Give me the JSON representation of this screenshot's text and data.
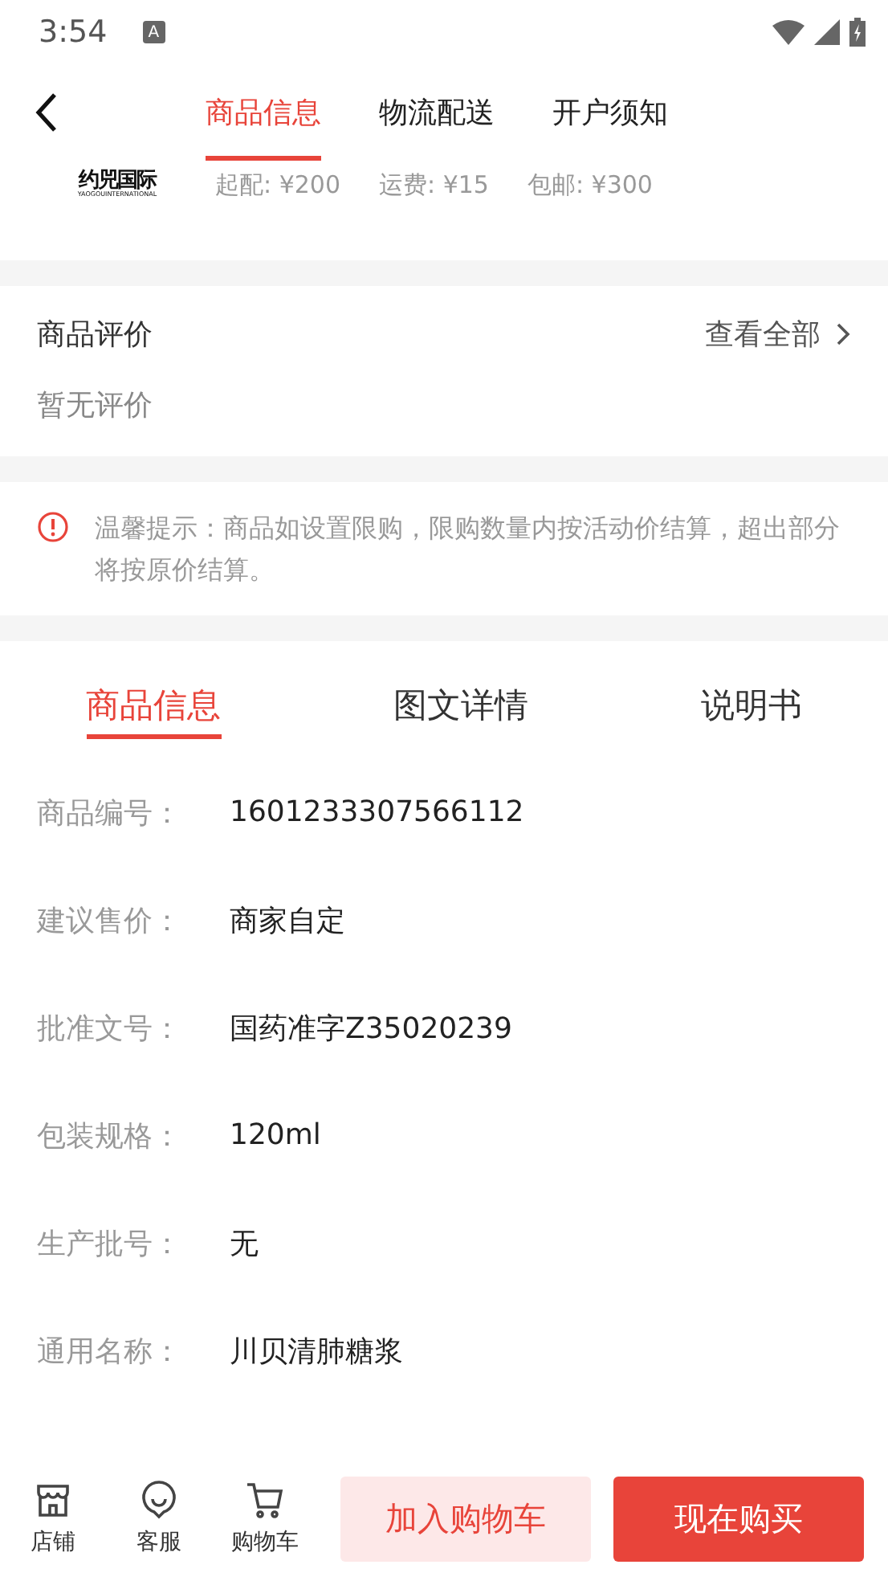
{
  "status_bar": {
    "time": "3:54",
    "notification": "A"
  },
  "header": {
    "tabs": [
      {
        "label": "商品信息",
        "selected": true
      },
      {
        "label": "物流配送",
        "selected": false
      },
      {
        "label": "开户须知",
        "selected": false
      }
    ]
  },
  "shop": {
    "logo_name": "约兕国际",
    "logo_sub": "YAOGOUINTERNATIONAL",
    "terms": [
      "起配: ¥200",
      "运费: ¥15",
      "包邮: ¥300"
    ]
  },
  "reviews": {
    "title": "商品评价",
    "link": "查看全部",
    "empty": "暂无评价"
  },
  "notice": "温馨提示：商品如设置限购，限购数量内按活动价结算，超出部分将按原价结算。",
  "detail_tabs": [
    {
      "label": "商品信息",
      "selected": true
    },
    {
      "label": "图文详情",
      "selected": false
    },
    {
      "label": "说明书",
      "selected": false
    }
  ],
  "specs": [
    {
      "label": "商品编号：",
      "value": "1601233307566112"
    },
    {
      "label": "建议售价：",
      "value": "商家自定"
    },
    {
      "label": "批准文号：",
      "value": "国药准字Z35020239"
    },
    {
      "label": "包装规格：",
      "value": "120ml"
    },
    {
      "label": "生产批号：",
      "value": "无"
    },
    {
      "label": "通用名称：",
      "value": "川贝清肺糖浆"
    }
  ],
  "bottom_bar": {
    "icons": [
      {
        "kind": "shop",
        "label": "店铺"
      },
      {
        "kind": "service",
        "label": "客服"
      },
      {
        "kind": "cart",
        "label": "购物车"
      }
    ],
    "add_to_cart": "加入购物车",
    "buy_now": "现在购买"
  }
}
